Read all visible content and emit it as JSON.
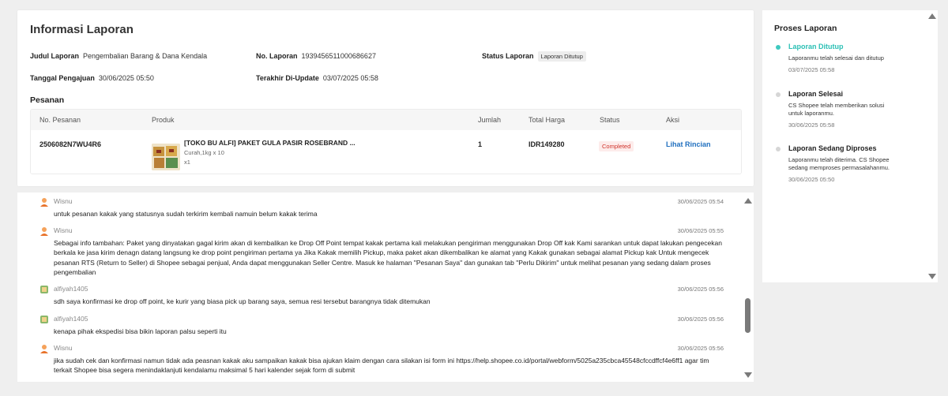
{
  "info": {
    "title": "Informasi Laporan",
    "judul_label": "Judul Laporan",
    "judul_value": "Pengembalian Barang & Dana Kendala",
    "no_label": "No. Laporan",
    "no_value": "1939456511000686627",
    "status_label": "Status Laporan",
    "status_value": "Laporan Ditutup",
    "tanggal_label": "Tanggal Pengajuan",
    "tanggal_value": "30/06/2025 05:50",
    "update_label": "Terakhir Di-Update",
    "update_value": "03/07/2025 05:58"
  },
  "orders": {
    "section_title": "Pesanan",
    "columns": [
      "No. Pesanan",
      "Produk",
      "Jumlah",
      "Total Harga",
      "Status",
      "Aksi"
    ],
    "row": {
      "order_no": "2506082N7WU4R6",
      "product_name": "[TOKO BU ALFI] PAKET GULA PASIR ROSEBRAND ...",
      "variant": "Curah,1kg x 10",
      "qty_small": "x1",
      "jumlah": "1",
      "total": "IDR149280",
      "status": "Completed",
      "action": "Lihat Rincian"
    }
  },
  "chat": {
    "messages": [
      {
        "name": "Wisnu",
        "time": "30/06/2025 05:54",
        "text": "untuk pesanan kakak yang statusnya sudah terkirim kembali namuin belum kakak terima",
        "avatar": "agent-avatar-icon"
      },
      {
        "name": "Wisnu",
        "time": "30/06/2025 05:55",
        "text": "Sebagai info tambahan: Paket yang dinyatakan gagal kirim akan di kembalikan ke Drop Off Point tempat kakak pertama kali melakukan pengiriman menggunakan Drop Off kak Kami sarankan untuk dapat lakukan pengecekan berkala ke jasa kirim denagn datang langsung ke drop point pengiriman pertama ya Jika Kakak memilih Pickup, maka paket akan dikembalikan ke alamat yang Kakak gunakan sebagai alamat Pickup kak Untuk mengecek pesanan RTS (Return to Seller) di Shopee sebagai penjual, Anda dapat menggunakan Seller Centre. Masuk ke halaman \"Pesanan Saya\" dan gunakan tab \"Perlu Dikirim\" untuk melihat pesanan yang sedang dalam proses pengembalian",
        "avatar": "agent-avatar-icon"
      },
      {
        "name": "alfiyah1405",
        "time": "30/06/2025 05:56",
        "text": "sdh saya konfirmasi ke drop off point, ke kurir yang biasa pick up barang saya, semua resi tersebut barangnya tidak ditemukan",
        "avatar": "user-avatar-icon"
      },
      {
        "name": "alfiyah1405",
        "time": "30/06/2025 05:56",
        "text": "kenapa pihak ekspedisi bisa bikin laporan palsu seperti itu",
        "avatar": "user-avatar-icon"
      },
      {
        "name": "Wisnu",
        "time": "30/06/2025 05:56",
        "text": "jika sudah cek dan konfirmasi namun tidak ada peasnan kakak aku sampaikan kakak bisa ajukan klaim dengan cara silakan isi form ini https://help.shopee.co.id/portal/webform/5025a235cbca45548cfccdffcf4e6ff1 agar tim terkait Shopee bisa segera menindaklanjuti kendalamu maksimal 5 hari kalender sejak form di submit",
        "avatar": "agent-avatar-icon"
      }
    ]
  },
  "process": {
    "title": "Proses Laporan",
    "steps": [
      {
        "title": "Laporan Ditutup",
        "desc": "Laporanmu telah selesai dan ditutup",
        "time": "03/07/2025 05:58"
      },
      {
        "title": "Laporan Selesai",
        "desc": "CS Shopee telah memberikan solusi untuk laporanmu.",
        "time": "30/06/2025 05:58"
      },
      {
        "title": "Laporan Sedang Diproses",
        "desc": "Laporanmu telah diterima. CS Shopee sedang memproses permasalahanmu.",
        "time": "30/06/2025 05:50"
      }
    ]
  },
  "colors": {
    "accent": "#2cc0b5",
    "link": "#1f6fbf",
    "status_red": "#d0332b"
  }
}
